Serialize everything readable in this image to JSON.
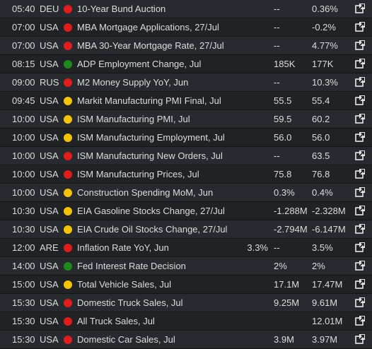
{
  "colors": {
    "background": "#1e1f21",
    "row_odd": "#272a2e",
    "row_even": "#202225",
    "impact_high": "#e21c1c",
    "impact_medium": "#f5c400",
    "impact_low": "#1e8a1e"
  },
  "icons": {
    "impact": "impact-dot-icon",
    "link": "external-link-icon"
  },
  "events": [
    {
      "time": "05:40",
      "country": "DEU",
      "impact": "high",
      "event": "10-Year Bund Auction",
      "actual": "",
      "forecast": "--",
      "previous": "0.36%"
    },
    {
      "time": "07:00",
      "country": "USA",
      "impact": "high",
      "event": "MBA Mortgage Applications, 27/Jul",
      "actual": "",
      "forecast": "--",
      "previous": "-0.2%"
    },
    {
      "time": "07:00",
      "country": "USA",
      "impact": "high",
      "event": "MBA 30-Year Mortgage Rate, 27/Jul",
      "actual": "",
      "forecast": "--",
      "previous": "4.77%"
    },
    {
      "time": "08:15",
      "country": "USA",
      "impact": "low",
      "event": "ADP Employment Change, Jul",
      "actual": "",
      "forecast": "185K",
      "previous": "177K"
    },
    {
      "time": "09:00",
      "country": "RUS",
      "impact": "high",
      "event": "M2 Money Supply YoY, Jun",
      "actual": "",
      "forecast": "--",
      "previous": "10.3%"
    },
    {
      "time": "09:45",
      "country": "USA",
      "impact": "medium",
      "event": "Markit Manufacturing PMI Final, Jul",
      "actual": "",
      "forecast": "55.5",
      "previous": "55.4"
    },
    {
      "time": "10:00",
      "country": "USA",
      "impact": "medium",
      "event": "ISM Manufacturing PMI, Jul",
      "actual": "",
      "forecast": "59.5",
      "previous": "60.2"
    },
    {
      "time": "10:00",
      "country": "USA",
      "impact": "medium",
      "event": "ISM Manufacturing Employment, Jul",
      "actual": "",
      "forecast": "56.0",
      "previous": "56.0"
    },
    {
      "time": "10:00",
      "country": "USA",
      "impact": "high",
      "event": "ISM Manufacturing New Orders, Jul",
      "actual": "",
      "forecast": "--",
      "previous": "63.5"
    },
    {
      "time": "10:00",
      "country": "USA",
      "impact": "high",
      "event": "ISM Manufacturing Prices, Jul",
      "actual": "",
      "forecast": "75.8",
      "previous": "76.8"
    },
    {
      "time": "10:00",
      "country": "USA",
      "impact": "medium",
      "event": "Construction Spending MoM, Jun",
      "actual": "",
      "forecast": "0.3%",
      "previous": "0.4%"
    },
    {
      "time": "10:30",
      "country": "USA",
      "impact": "medium",
      "event": "EIA Gasoline Stocks Change, 27/Jul",
      "actual": "",
      "forecast": "-1.288M",
      "previous": "-2.328M"
    },
    {
      "time": "10:30",
      "country": "USA",
      "impact": "medium",
      "event": "EIA Crude Oil Stocks Change, 27/Jul",
      "actual": "",
      "forecast": "-2.794M",
      "previous": "-6.147M"
    },
    {
      "time": "12:00",
      "country": "ARE",
      "impact": "high",
      "event": "Inflation Rate YoY, Jun",
      "actual": "3.3%",
      "forecast": "--",
      "previous": "3.5%"
    },
    {
      "time": "14:00",
      "country": "USA",
      "impact": "low",
      "event": "Fed Interest Rate Decision",
      "actual": "",
      "forecast": "2%",
      "previous": "2%"
    },
    {
      "time": "15:00",
      "country": "USA",
      "impact": "medium",
      "event": "Total Vehicle Sales, Jul",
      "actual": "",
      "forecast": "17.1M",
      "previous": "17.47M"
    },
    {
      "time": "15:30",
      "country": "USA",
      "impact": "high",
      "event": "Domestic Truck Sales, Jul",
      "actual": "",
      "forecast": "9.25M",
      "previous": "9.61M"
    },
    {
      "time": "15:30",
      "country": "USA",
      "impact": "high",
      "event": "All Truck Sales, Jul",
      "actual": "",
      "forecast": "",
      "previous": "12.01M"
    },
    {
      "time": "15:30",
      "country": "USA",
      "impact": "high",
      "event": "Domestic Car Sales, Jul",
      "actual": "",
      "forecast": "3.9M",
      "previous": "3.97M"
    }
  ]
}
